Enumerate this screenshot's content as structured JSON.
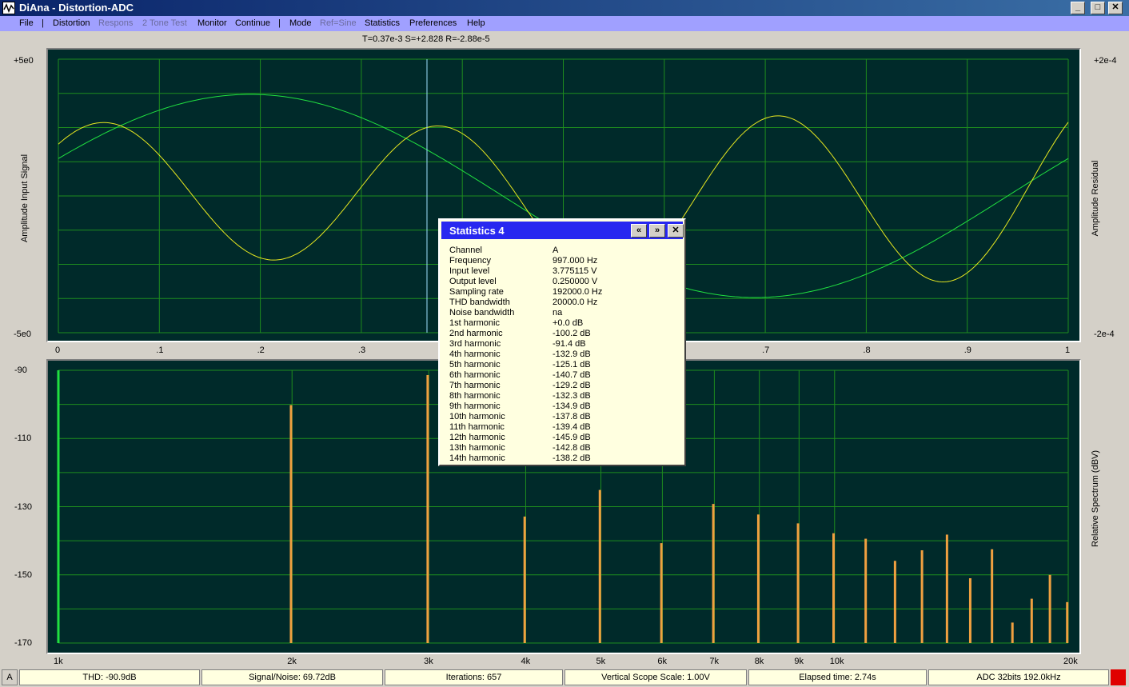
{
  "window": {
    "title": "DiAna - Distortion-ADC"
  },
  "menu": [
    {
      "label": "File",
      "enabled": true
    },
    {
      "label": "|",
      "separator": true
    },
    {
      "label": "Distortion",
      "enabled": true
    },
    {
      "label": "Respons",
      "enabled": false
    },
    {
      "label": "2 Tone Test",
      "enabled": false
    },
    {
      "label": "Monitor",
      "enabled": true
    },
    {
      "label": "Continue",
      "enabled": true
    },
    {
      "label": "|",
      "separator": true
    },
    {
      "label": "Mode",
      "enabled": true
    },
    {
      "label": "Ref=Sine",
      "enabled": false
    },
    {
      "label": "Statistics",
      "enabled": true
    },
    {
      "label": "Preferences",
      "enabled": true
    },
    {
      "label": "Help",
      "enabled": true
    }
  ],
  "cursor_readout": "T=0.37e-3  S=+2.828  R=-2.88e-5",
  "scope": {
    "left_top": "+5e0",
    "left_bottom": "-5e0",
    "right_top": "+2e-4",
    "right_bottom": "-2e-4",
    "left_axis_label": "Amplitude Input Signal",
    "right_axis_label": "Amplitude Residual",
    "x_ticks": [
      "0",
      ".1",
      ".2",
      ".3",
      ".4",
      ".5",
      ".6",
      ".7",
      ".8",
      ".9",
      "1"
    ],
    "cursor_x": 0.365,
    "colors": {
      "background": "#002a2a",
      "grid": "#1e8c1e",
      "input": "#20e040",
      "residual": "#e8e820",
      "cursor": "#a0e0ff"
    }
  },
  "spectrum": {
    "y_ticks": [
      "-90",
      "-110",
      "-130",
      "-150",
      "-170"
    ],
    "y_range": [
      -170,
      -90
    ],
    "axis_label": "Relative Spectrum (dBV)",
    "x_ticks": [
      "1k",
      "2k",
      "3k",
      "4k",
      "5k",
      "6k",
      "7k",
      "8k",
      "9k",
      "10k",
      "20k"
    ],
    "x_tick_values": [
      1000,
      2000,
      3000,
      4000,
      5000,
      6000,
      7000,
      8000,
      9000,
      10000,
      20000
    ],
    "x_range": [
      1000,
      20000
    ],
    "fundamental": {
      "freq": 1000,
      "level": -90
    },
    "bars": [
      {
        "freq": 1994,
        "level": -100.2
      },
      {
        "freq": 2991,
        "level": -91.4
      },
      {
        "freq": 3988,
        "level": -132.9
      },
      {
        "freq": 4985,
        "level": -125.1
      },
      {
        "freq": 5982,
        "level": -140.7
      },
      {
        "freq": 6979,
        "level": -129.2
      },
      {
        "freq": 7976,
        "level": -132.3
      },
      {
        "freq": 8973,
        "level": -134.9
      },
      {
        "freq": 9970,
        "level": -137.8
      },
      {
        "freq": 10967,
        "level": -139.4
      },
      {
        "freq": 11964,
        "level": -145.9
      },
      {
        "freq": 12961,
        "level": -142.8
      },
      {
        "freq": 13958,
        "level": -138.2
      },
      {
        "freq": 14955,
        "level": -151
      },
      {
        "freq": 15952,
        "level": -142.5
      },
      {
        "freq": 16949,
        "level": -164
      },
      {
        "freq": 17946,
        "level": -157
      },
      {
        "freq": 18943,
        "level": -150
      },
      {
        "freq": 19940,
        "level": -158
      }
    ],
    "colors": {
      "fundamental": "#20e040",
      "harmonic": "#f0a040"
    }
  },
  "stats_dialog": {
    "title": "Statistics 4",
    "rows": [
      {
        "label": "Channel",
        "value": "A"
      },
      {
        "label": "Frequency",
        "value": "997.000 Hz"
      },
      {
        "label": "Input level",
        "value": "3.775115 V"
      },
      {
        "label": "Output level",
        "value": "0.250000 V"
      },
      {
        "label": "Sampling rate",
        "value": "192000.0 Hz"
      },
      {
        "label": "THD bandwidth",
        "value": "20000.0 Hz"
      },
      {
        "label": "Noise bandwidth",
        "value": "na"
      },
      {
        "label": "1st harmonic",
        "value": "+0.0 dB"
      },
      {
        "label": "2nd harmonic",
        "value": "-100.2 dB"
      },
      {
        "label": "3rd harmonic",
        "value": "-91.4 dB"
      },
      {
        "label": "4th harmonic",
        "value": "-132.9 dB"
      },
      {
        "label": "5th harmonic",
        "value": "-125.1 dB"
      },
      {
        "label": "6th harmonic",
        "value": "-140.7 dB"
      },
      {
        "label": "7th harmonic",
        "value": "-129.2 dB"
      },
      {
        "label": "8th harmonic",
        "value": "-132.3 dB"
      },
      {
        "label": "9th harmonic",
        "value": "-134.9 dB"
      },
      {
        "label": "10th harmonic",
        "value": "-137.8 dB"
      },
      {
        "label": "11th harmonic",
        "value": "-139.4 dB"
      },
      {
        "label": "12th harmonic",
        "value": "-145.9 dB"
      },
      {
        "label": "13th harmonic",
        "value": "-142.8 dB"
      },
      {
        "label": "14th harmonic",
        "value": "-138.2 dB"
      }
    ]
  },
  "status": {
    "channel": "A",
    "thd": "THD:  -90.9dB",
    "snr": "Signal/Noise:  69.72dB",
    "iterations": "Iterations: 657",
    "scope_scale": "Vertical Scope Scale: 1.00V",
    "elapsed": "Elapsed time: 2.74s",
    "adc": "ADC 32bits 192.0kHz"
  }
}
